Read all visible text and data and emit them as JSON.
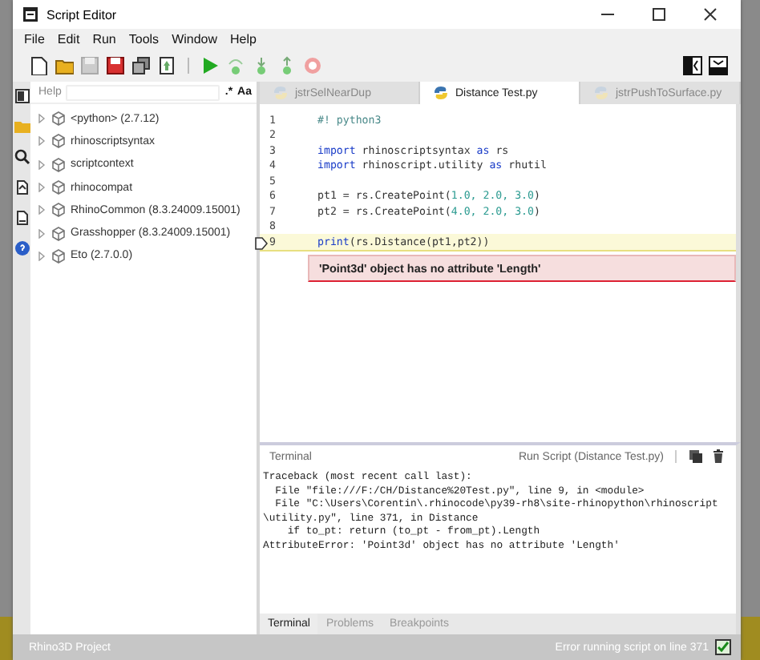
{
  "window": {
    "title": "Script Editor"
  },
  "menu": [
    "File",
    "Edit",
    "Run",
    "Tools",
    "Window",
    "Help"
  ],
  "help_panel": {
    "label": "Help",
    "regex_toggle": ".*",
    "case_toggle": "Aa",
    "tree": [
      {
        "label": "<python> (2.7.12)",
        "expanded": false
      },
      {
        "label": "rhinoscriptsyntax",
        "expanded": false
      },
      {
        "label": "scriptcontext",
        "expanded": false
      },
      {
        "label": "rhinocompat",
        "expanded": false
      },
      {
        "label": "RhinoCommon (8.3.24009.15001)",
        "expanded": false
      },
      {
        "label": "Grasshopper (8.3.24009.15001)",
        "expanded": false
      },
      {
        "label": "Eto (2.7.0.0)",
        "expanded": false
      }
    ]
  },
  "tabs": [
    {
      "label": "jstrSelNearDup",
      "selected": false
    },
    {
      "label": "Distance Test.py",
      "selected": true
    },
    {
      "label": "jstrPushToSurface.py",
      "selected": false
    }
  ],
  "code": [
    {
      "number": "1",
      "highlighted": false,
      "parts": [
        {
          "text": "#! python3",
          "kind": "comment"
        }
      ]
    },
    {
      "number": "2",
      "highlighted": false
    },
    {
      "number": "3",
      "highlighted": false,
      "parts": [
        {
          "text": "import",
          "kind": "keyword"
        },
        {
          "text": " rhinoscriptsyntax ",
          "kind": "plain"
        },
        {
          "text": "as",
          "kind": "keyword"
        },
        {
          "text": " rs",
          "kind": "plain"
        }
      ]
    },
    {
      "number": "4",
      "highlighted": false,
      "parts": [
        {
          "text": "import",
          "kind": "keyword"
        },
        {
          "text": " rhinoscript.utility ",
          "kind": "plain"
        },
        {
          "text": "as",
          "kind": "keyword"
        },
        {
          "text": " rhutil",
          "kind": "plain"
        }
      ]
    },
    {
      "number": "5",
      "highlighted": false
    },
    {
      "number": "6",
      "highlighted": false,
      "parts": [
        {
          "text": "pt1 = rs.CreatePoint(",
          "kind": "plain"
        },
        {
          "text": "1.0, 2.0, 3.0",
          "kind": "number"
        },
        {
          "text": ")",
          "kind": "plain"
        }
      ]
    },
    {
      "number": "7",
      "highlighted": false,
      "parts": [
        {
          "text": "pt2 = rs.CreatePoint(",
          "kind": "plain"
        },
        {
          "text": "4.0, 2.0, 3.0",
          "kind": "number"
        },
        {
          "text": ")",
          "kind": "plain"
        }
      ]
    },
    {
      "number": "8",
      "highlighted": false
    },
    {
      "number": "9",
      "highlighted": true,
      "parts": [
        {
          "text": "print",
          "kind": "keyword"
        },
        {
          "text": "(rs.Distance(pt1,pt2))",
          "kind": "plain"
        }
      ]
    }
  ],
  "error_hint": "'Point3d' object has no attribute 'Length'",
  "terminal": {
    "title": "Terminal",
    "run_label": "Run Script (Distance Test.py)",
    "output": [
      "Traceback (most recent call last):",
      "  File \"file:///F:/CH/Distance%20Test.py\", line 9, in <module>",
      "  File \"C:\\Users\\Corentin\\.rhinocode\\py39-rh8\\site-rhinopython\\rhinoscript",
      "\\utility.py\", line 371, in Distance",
      "    if to_pt: return (to_pt - from_pt).Length",
      "AttributeError: 'Point3d' object has no attribute 'Length'"
    ],
    "tabs": [
      {
        "label": "Terminal",
        "selected": true
      },
      {
        "label": "Problems",
        "selected": false
      },
      {
        "label": "Breakpoints",
        "selected": false
      }
    ]
  },
  "status_bar": {
    "left": "Rhino3D Project",
    "right": "Error running script on line 371",
    "checked": true
  }
}
